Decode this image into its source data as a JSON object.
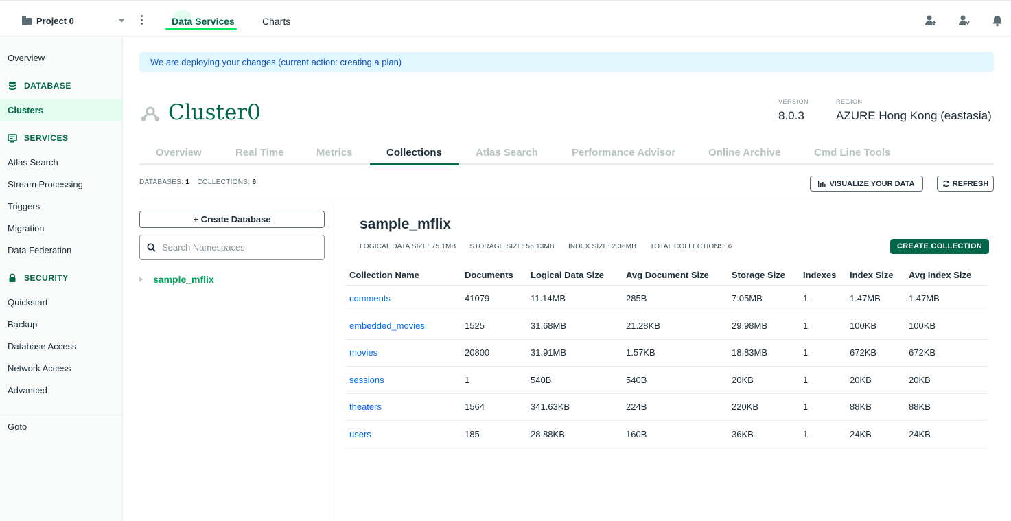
{
  "header": {
    "project": "Project 0",
    "tabs": [
      {
        "label": "Data Services",
        "active": true
      },
      {
        "label": "Charts",
        "active": false
      }
    ],
    "icons": [
      "invite-user-icon",
      "activity-icon",
      "notification-bell-icon"
    ]
  },
  "sidebar": {
    "overview": "Overview",
    "database_section": "DATABASE",
    "clusters": "Clusters",
    "services_section": "SERVICES",
    "services": [
      "Atlas Search",
      "Stream Processing",
      "Triggers",
      "Migration",
      "Data Federation"
    ],
    "security_section": "SECURITY",
    "security": [
      "Quickstart",
      "Backup",
      "Database Access",
      "Network Access",
      "Advanced"
    ],
    "goto": "Goto"
  },
  "banner": "We are deploying your changes (current action: creating a plan)",
  "cluster": {
    "name": "Cluster0",
    "version_label": "VERSION",
    "version": "8.0.3",
    "region_label": "REGION",
    "region": "AZURE Hong Kong (eastasia)"
  },
  "cluster_tabs": [
    {
      "label": "Overview",
      "active": false
    },
    {
      "label": "Real Time",
      "active": false
    },
    {
      "label": "Metrics",
      "active": false
    },
    {
      "label": "Collections",
      "active": true
    },
    {
      "label": "Atlas Search",
      "active": false
    },
    {
      "label": "Performance Advisor",
      "active": false
    },
    {
      "label": "Online Archive",
      "active": false
    },
    {
      "label": "Cmd Line Tools",
      "active": false
    }
  ],
  "counts": {
    "databases_label": "DATABASES:",
    "databases": "1",
    "collections_label": "COLLECTIONS:",
    "collections": "6"
  },
  "buttons": {
    "visualize": "VISUALIZE YOUR DATA",
    "refresh": "REFRESH",
    "create_database": "+ Create Database",
    "create_collection": "CREATE COLLECTION"
  },
  "search": {
    "placeholder": "Search Namespaces",
    "value": ""
  },
  "databases": [
    "sample_mflix"
  ],
  "selected_db": {
    "name": "sample_mflix",
    "logical_size": "LOGICAL DATA SIZE: 75.1MB",
    "storage_size": "STORAGE SIZE: 56.13MB",
    "index_size": "INDEX SIZE: 2.36MB",
    "total_collections": "TOTAL COLLECTIONS: 6"
  },
  "table": {
    "columns": [
      "Collection Name",
      "Documents",
      "Logical Data Size",
      "Avg Document Size",
      "Storage Size",
      "Indexes",
      "Index Size",
      "Avg Index Size"
    ],
    "rows": [
      [
        "comments",
        "41079",
        "11.14MB",
        "285B",
        "7.05MB",
        "1",
        "1.47MB",
        "1.47MB"
      ],
      [
        "embedded_movies",
        "1525",
        "31.68MB",
        "21.28KB",
        "29.98MB",
        "1",
        "100KB",
        "100KB"
      ],
      [
        "movies",
        "20800",
        "31.91MB",
        "1.57KB",
        "18.83MB",
        "1",
        "672KB",
        "672KB"
      ],
      [
        "sessions",
        "1",
        "540B",
        "540B",
        "20KB",
        "1",
        "20KB",
        "20KB"
      ],
      [
        "theaters",
        "1564",
        "341.63KB",
        "224B",
        "220KB",
        "1",
        "88KB",
        "88KB"
      ],
      [
        "users",
        "185",
        "28.88KB",
        "160B",
        "36KB",
        "1",
        "24KB",
        "24KB"
      ]
    ]
  },
  "colors": {
    "brand_green": "#00684a",
    "accent_green": "#00ed64",
    "link_blue": "#016bf8",
    "banner_bg": "#e1f7ff"
  }
}
